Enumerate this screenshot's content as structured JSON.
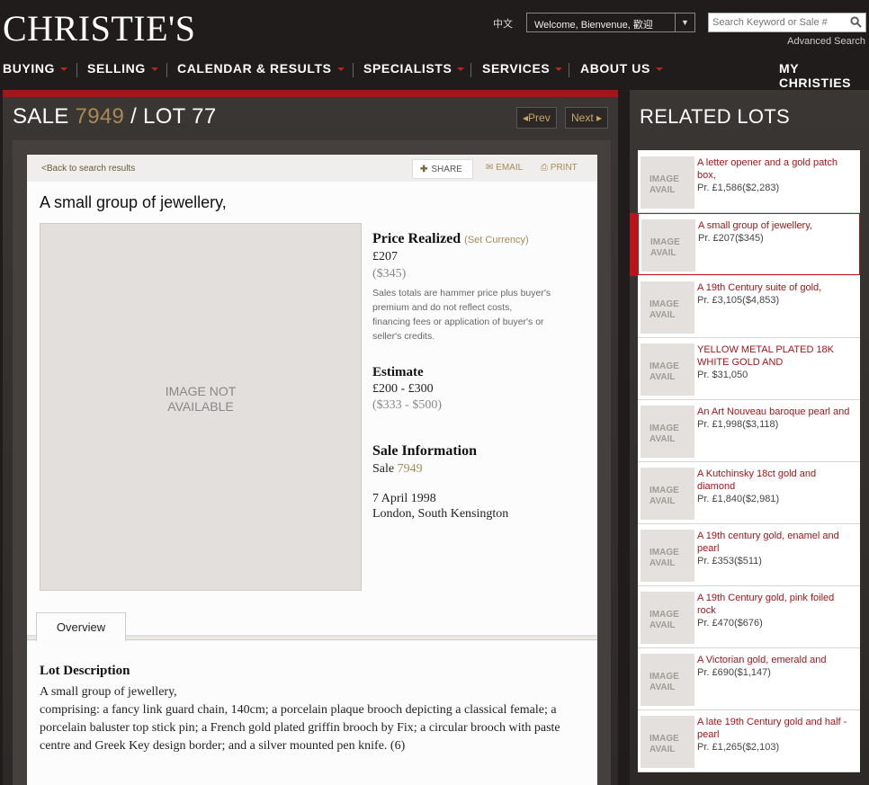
{
  "header": {
    "logo": "CHRISTIE'S",
    "lang": "中文",
    "welcome": "Welcome, Bienvenue, 歡迎",
    "search_placeholder": "Search Keyword or Sale #",
    "advanced_search": "Advanced Search"
  },
  "nav": {
    "items": [
      "BUYING",
      "SELLING",
      "CALENDAR & RESULTS",
      "SPECIALISTS",
      "SERVICES",
      "ABOUT US"
    ],
    "my": "MY CHRISTIES"
  },
  "lot": {
    "sale_label": "SALE",
    "sale_number": "7949",
    "slash": "/",
    "lot_label": "LOT",
    "lot_number": "77",
    "prev": "Prev",
    "next": "Next",
    "back": "<Back to search results",
    "share": "SHARE",
    "email": "EMAIL",
    "print": "PRINT",
    "title": "A small group of jewellery,",
    "image_na_1": "IMAGE NOT",
    "image_na_2": "AVAILABLE",
    "price_realized_label": "Price Realized",
    "set_currency": "(Set Currency)",
    "price_gbp": "£207",
    "price_usd": "($345)",
    "price_note": "Sales totals are hammer price plus buyer's premium and do not reflect costs, financing fees or application of buyer's or seller's credits.",
    "estimate_label": "Estimate",
    "estimate_gbp": "£200 - £300",
    "estimate_usd": "($333 - $500)",
    "sale_info_label": "Sale Information",
    "sale_prefix": "Sale",
    "sale_link": "7949",
    "sale_date": "7 April 1998",
    "sale_location": "London, South Kensington",
    "tab_overview": "Overview",
    "description_label": "Lot Description",
    "description_line1": "A small group of jewellery,",
    "description_line2": "comprising: a fancy link guard chain, 140cm; a porcelain plaque brooch depicting a classical female; a porcelain baluster top stick pin; a French gold plated griffin brooch by Fix; a circular brooch with paste centre and Greek Key design border; and a silver mounted pen knife. (6)"
  },
  "related": {
    "title": "RELATED LOTS",
    "thumb_text_1": "IMAGE",
    "thumb_text_2": "AVAIL",
    "items": [
      {
        "title": "A letter opener and a gold patch box,",
        "price": "Pr. £1,586($2,283)"
      },
      {
        "title": "A small group of jewellery,",
        "price": "Pr. £207($345)"
      },
      {
        "title": "A 19th Century suite of gold,",
        "price": "Pr. £3,105($4,853)"
      },
      {
        "title": "YELLOW METAL PLATED 18K WHITE GOLD AND",
        "price": "Pr. $31,050"
      },
      {
        "title": "An Art Nouveau baroque pearl and",
        "price": "Pr. £1,998($3,118)"
      },
      {
        "title": "A Kutchinsky 18ct gold and diamond",
        "price": "Pr. £1,840($2,981)"
      },
      {
        "title": "A 19th century gold, enamel and pearl",
        "price": "Pr. £353($511)"
      },
      {
        "title": "A 19th Century gold, pink foiled rock",
        "price": "Pr. £470($676)"
      },
      {
        "title": "A Victorian gold, emerald and",
        "price": "Pr. £690($1,147)"
      },
      {
        "title": "A late 19th Century gold and half -pearl",
        "price": "Pr. £1,265($2,103)"
      }
    ]
  }
}
